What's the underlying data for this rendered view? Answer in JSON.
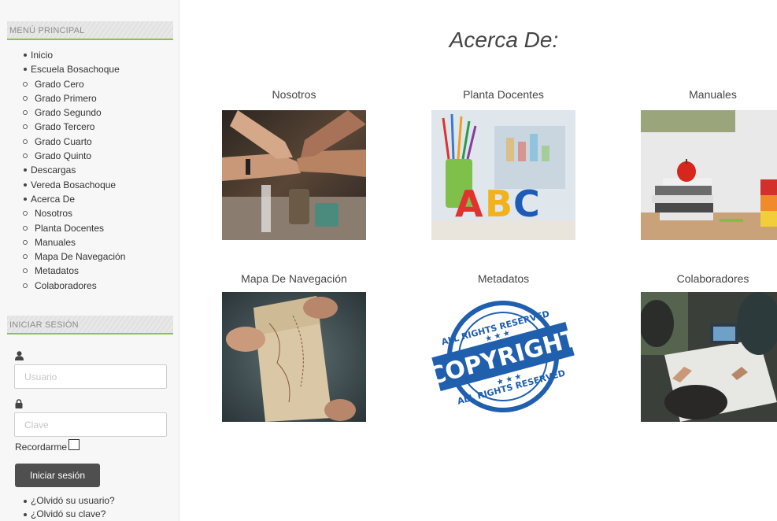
{
  "sidebar": {
    "menu_title": "MENÚ PRINCIPAL",
    "menu": [
      {
        "label": "Inicio",
        "level": 1
      },
      {
        "label": "Escuela Bosachoque",
        "level": 1
      },
      {
        "label": "Grado Cero",
        "level": 2
      },
      {
        "label": "Grado Primero",
        "level": 2
      },
      {
        "label": "Grado Segundo",
        "level": 2
      },
      {
        "label": "Grado Tercero",
        "level": 2
      },
      {
        "label": "Grado Cuarto",
        "level": 2
      },
      {
        "label": "Grado Quinto",
        "level": 2
      },
      {
        "label": "Descargas",
        "level": 1
      },
      {
        "label": "Vereda Bosachoque",
        "level": 1
      },
      {
        "label": "Acerca De",
        "level": 1
      },
      {
        "label": "Nosotros",
        "level": 2
      },
      {
        "label": "Planta Docentes",
        "level": 2
      },
      {
        "label": "Manuales",
        "level": 2
      },
      {
        "label": "Mapa De Navegación",
        "level": 2
      },
      {
        "label": "Metadatos",
        "level": 2
      },
      {
        "label": "Colaboradores",
        "level": 2
      }
    ],
    "login": {
      "title": "INICIAR SESIÓN",
      "user_placeholder": "Usuario",
      "user_value": "",
      "password_placeholder": "Clave",
      "password_value": "",
      "remember_label": "Recordarme",
      "remember_checked": false,
      "submit_label": "Iniciar sesión",
      "user_icon": "user-icon",
      "lock_icon": "lock-icon",
      "links": [
        "¿Olvidó su usuario?",
        "¿Olvidó su clave?"
      ]
    }
  },
  "main": {
    "title": "Acerca De:",
    "cards": [
      {
        "label": "Nosotros",
        "image": "team-fist-bump-photo"
      },
      {
        "label": "Planta Docentes",
        "image": "abc-classroom-photo"
      },
      {
        "label": "Manuales",
        "image": "books-apple-blocks-photo"
      },
      {
        "label": "Mapa De Navegación",
        "image": "old-map-photo"
      },
      {
        "label": "Metadatos",
        "image": "copyright-stamp-image"
      },
      {
        "label": "Colaboradores",
        "image": "team-meeting-photo"
      }
    ],
    "stamp": {
      "top_text": "ALL RIGHTS RESERVED",
      "center_text": "COPYRIGHT",
      "bottom_text": "ALL RIGHTS RESERVED"
    }
  },
  "colors": {
    "accent_green": "#8ec342",
    "button_bg": "#4f4f4f",
    "stamp_blue": "#1f5fae"
  }
}
